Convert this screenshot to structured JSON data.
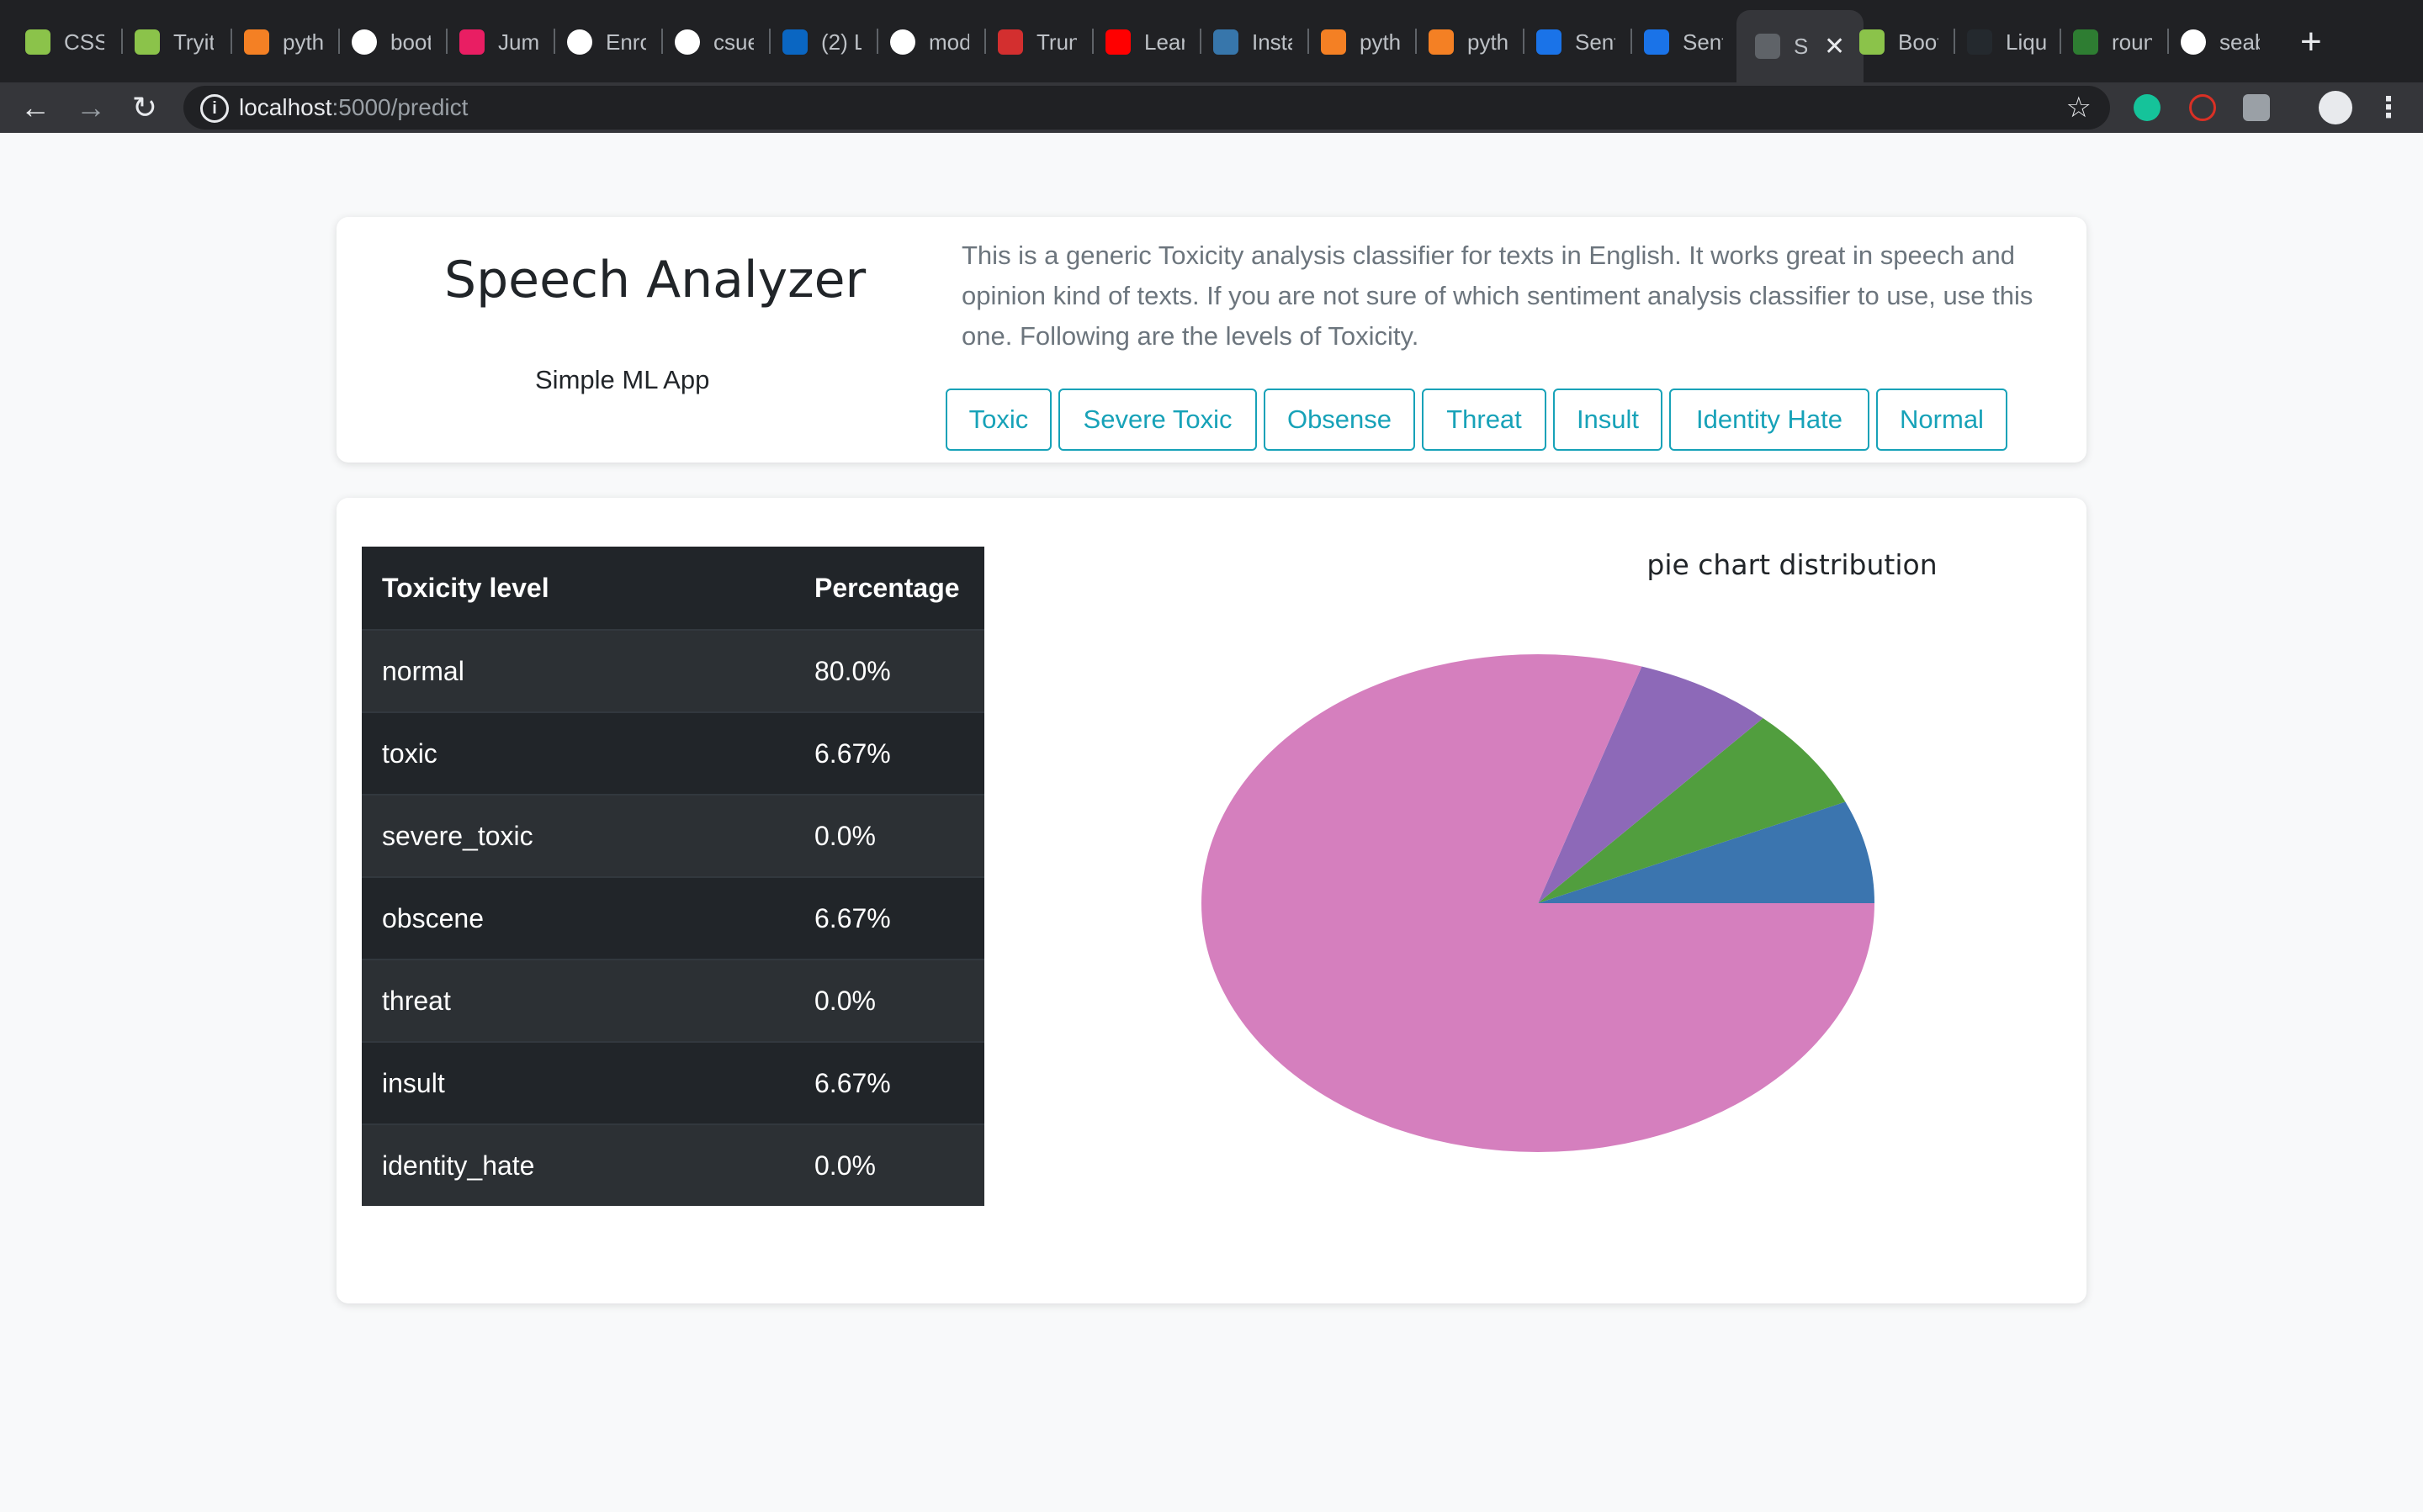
{
  "browser": {
    "tabs": [
      {
        "title": "CSS",
        "icon": "w3schools-icon",
        "color": "#8bc34a"
      },
      {
        "title": "Tryit",
        "icon": "w3schools-icon",
        "color": "#8bc34a"
      },
      {
        "title": "pyth",
        "icon": "stackoverflow-icon",
        "color": "#f48024"
      },
      {
        "title": "boot",
        "icon": "google-icon",
        "color": "#ffffff"
      },
      {
        "title": "Jum",
        "icon": "jump-icon",
        "color": "#e91e63"
      },
      {
        "title": "Enro",
        "icon": "eb-icon",
        "color": "#ffffff"
      },
      {
        "title": "csue",
        "icon": "google-icon",
        "color": "#ffffff"
      },
      {
        "title": "(2) L",
        "icon": "linkedin-icon",
        "color": "#0a66c2"
      },
      {
        "title": "mod",
        "icon": "google-icon",
        "color": "#ffffff"
      },
      {
        "title": "Trun",
        "icon": "trun-icon",
        "color": "#d32f2f"
      },
      {
        "title": "Lear",
        "icon": "youtube-icon",
        "color": "#ff0000"
      },
      {
        "title": "Insta",
        "icon": "python-icon",
        "color": "#3776ab"
      },
      {
        "title": "pyth",
        "icon": "stackoverflow-icon",
        "color": "#f48024"
      },
      {
        "title": "pyth",
        "icon": "stackoverflow-icon",
        "color": "#f48024"
      },
      {
        "title": "Sent",
        "icon": "shield-icon",
        "color": "#1a73e8"
      },
      {
        "title": "Sent",
        "icon": "shield-icon",
        "color": "#1a73e8"
      },
      {
        "title": "S",
        "icon": "globe-icon",
        "color": "#5f6368",
        "active": true
      },
      {
        "title": "Boot",
        "icon": "w3schools-icon",
        "color": "#8bc34a"
      },
      {
        "title": "Liqu",
        "icon": "github-icon",
        "color": "#24292e"
      },
      {
        "title": "roun",
        "icon": "dg-icon",
        "color": "#2e7d32"
      },
      {
        "title": "seab",
        "icon": "google-icon",
        "color": "#ffffff"
      }
    ],
    "url_host": "localhost",
    "url_path": ":5000/predict"
  },
  "header": {
    "title": "Speech Analyzer",
    "subtitle": "Simple ML App",
    "description": "This is a generic Toxicity analysis classifier for texts in English. It works great in speech and opinion kind of texts. If you are not sure of which sentiment analysis classifier to use, use this one. Following are the levels of Toxicity.",
    "buttons": [
      "Toxic",
      "Severe Toxic",
      "Obsense",
      "Threat",
      "Insult",
      "Identity Hate",
      "Normal"
    ]
  },
  "table": {
    "headers": [
      "Toxicity level",
      "Percentage"
    ],
    "rows": [
      [
        "normal",
        "80.0%"
      ],
      [
        "toxic",
        "6.67%"
      ],
      [
        "severe_toxic",
        "0.0%"
      ],
      [
        "obscene",
        "6.67%"
      ],
      [
        "threat",
        "0.0%"
      ],
      [
        "insult",
        "6.67%"
      ],
      [
        "identity_hate",
        "0.0%"
      ]
    ]
  },
  "chart_data": {
    "type": "pie",
    "title": "pie chart distribution",
    "slices": [
      {
        "label": "toxic",
        "value": 6.67,
        "color": "#3b75af"
      },
      {
        "label": "obscene",
        "value": 6.67,
        "color": "#519e3e"
      },
      {
        "label": "insult",
        "value": 6.67,
        "color": "#8d69b8"
      },
      {
        "label": "normal",
        "value": 80.0,
        "color": "#d57fbe"
      }
    ]
  }
}
